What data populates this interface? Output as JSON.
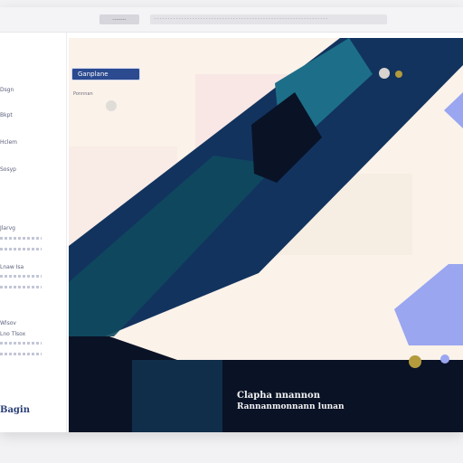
{
  "window": {
    "tab_label": "-------",
    "url": "----------------------------------------------------------------"
  },
  "sidebar": {
    "items": [
      {
        "label": "Dsgn"
      },
      {
        "label": "Bkpt"
      },
      {
        "label": "Hclem"
      },
      {
        "label": "Sosyp"
      },
      {
        "label": "Jlarvg"
      },
      {
        "label": "Lnaw Isa"
      },
      {
        "label": "Wlsov"
      },
      {
        "label": "Lno Tlsox"
      }
    ],
    "brand": "Bagin"
  },
  "hero": {
    "button_label": "Ganplane",
    "subtitle": "Ponnnan",
    "caption_line1": "Clapha nnannon",
    "caption_line2": "Rannanmonnann lunan"
  },
  "colors": {
    "navy": "#12335e",
    "teal": "#1d6f89",
    "dark": "#0a1226",
    "lavender": "#9aa6f0",
    "gold": "#b39a3c",
    "cream": "#fbf2ea"
  }
}
